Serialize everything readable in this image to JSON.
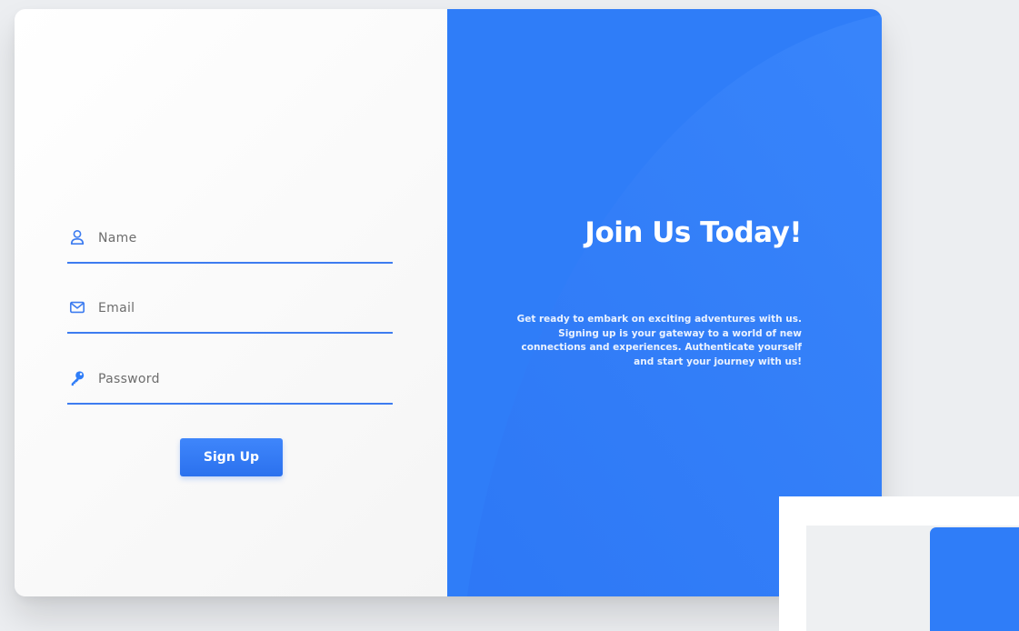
{
  "form": {
    "name_placeholder": "Name",
    "email_placeholder": "Email",
    "password_placeholder": "Password",
    "submit_label": "Sign Up"
  },
  "hero": {
    "title": "Join Us Today!",
    "description": "Get ready to embark on exciting adventures with us. Signing up is your gateway to a world of new connections and experiences. Authenticate yourself and start your journey with us!"
  },
  "colors": {
    "accent": "#2f7df8",
    "underline": "#3d7cf0",
    "background": "#eceef1"
  },
  "icons": {
    "name": "user-icon",
    "email": "envelope-icon",
    "password": "key-icon"
  }
}
